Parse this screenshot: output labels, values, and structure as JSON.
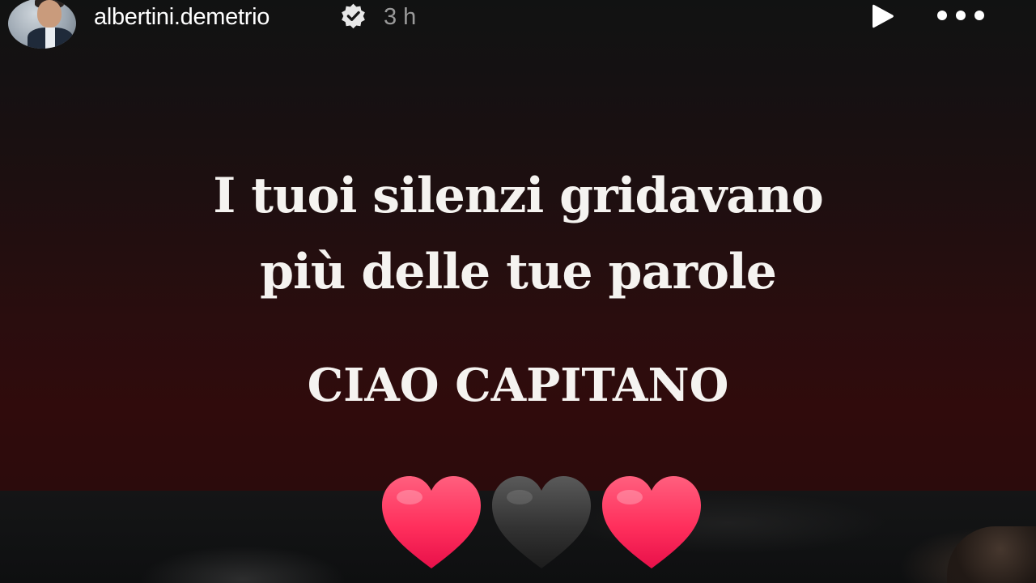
{
  "story": {
    "username": "albertini.demetrio",
    "timestamp": "3 h",
    "caption": {
      "line1": "I tuoi silenzi gridavano",
      "line2": "più delle tue parole",
      "line3": "CIAO CAPITANO"
    },
    "hearts": [
      "red-heart",
      "black-heart",
      "red-heart"
    ]
  },
  "colors": {
    "text": "#f5f3f0",
    "timestamp": "#9a9a9a",
    "heart_red": "#ff3d66",
    "heart_black": "#3a3a3a",
    "background_top": "#111212",
    "background_bottom": "#300b0c"
  },
  "icons": {
    "verified": "verified-badge-icon",
    "play": "play-icon",
    "more": "more-options-icon"
  }
}
